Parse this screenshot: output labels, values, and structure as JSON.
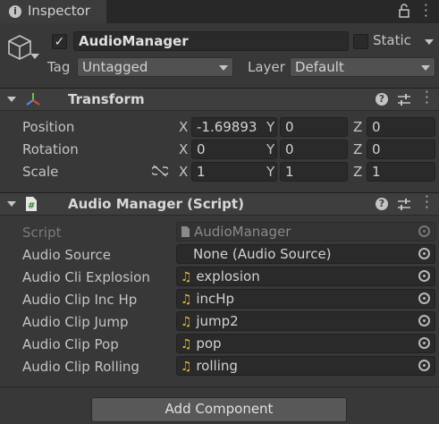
{
  "tab": {
    "title": "Inspector"
  },
  "header": {
    "object_name": "AudioManager",
    "static_label": "Static",
    "tag_label": "Tag",
    "tag_value": "Untagged",
    "layer_label": "Layer",
    "layer_value": "Default"
  },
  "transform": {
    "title": "Transform",
    "rows": [
      {
        "label": "Position",
        "x": "-1.69893",
        "y": "0",
        "z": "0"
      },
      {
        "label": "Rotation",
        "x": "0",
        "y": "0",
        "z": "0"
      },
      {
        "label": "Scale",
        "x": "1",
        "y": "1",
        "z": "1"
      }
    ],
    "axis_labels": [
      "X",
      "Y",
      "Z"
    ]
  },
  "script_component": {
    "title": "Audio Manager (Script)",
    "script_label": "Script",
    "script_value": "AudioManager",
    "fields": [
      {
        "label": "Audio Source",
        "value": "None (Audio Source)",
        "icon": ""
      },
      {
        "label": "Audio Cli Explosion",
        "value": "explosion",
        "icon": "audio-clip-icon"
      },
      {
        "label": "Audio Clip Inc Hp",
        "value": "incHp",
        "icon": "audio-clip-icon"
      },
      {
        "label": "Audio Clip Jump",
        "value": "jump2",
        "icon": "audio-clip-icon"
      },
      {
        "label": "Audio Clip Pop",
        "value": "pop",
        "icon": "audio-clip-icon"
      },
      {
        "label": "Audio Clip Rolling",
        "value": "rolling",
        "icon": "audio-clip-icon"
      }
    ]
  },
  "add_component": {
    "label": "Add Component"
  }
}
